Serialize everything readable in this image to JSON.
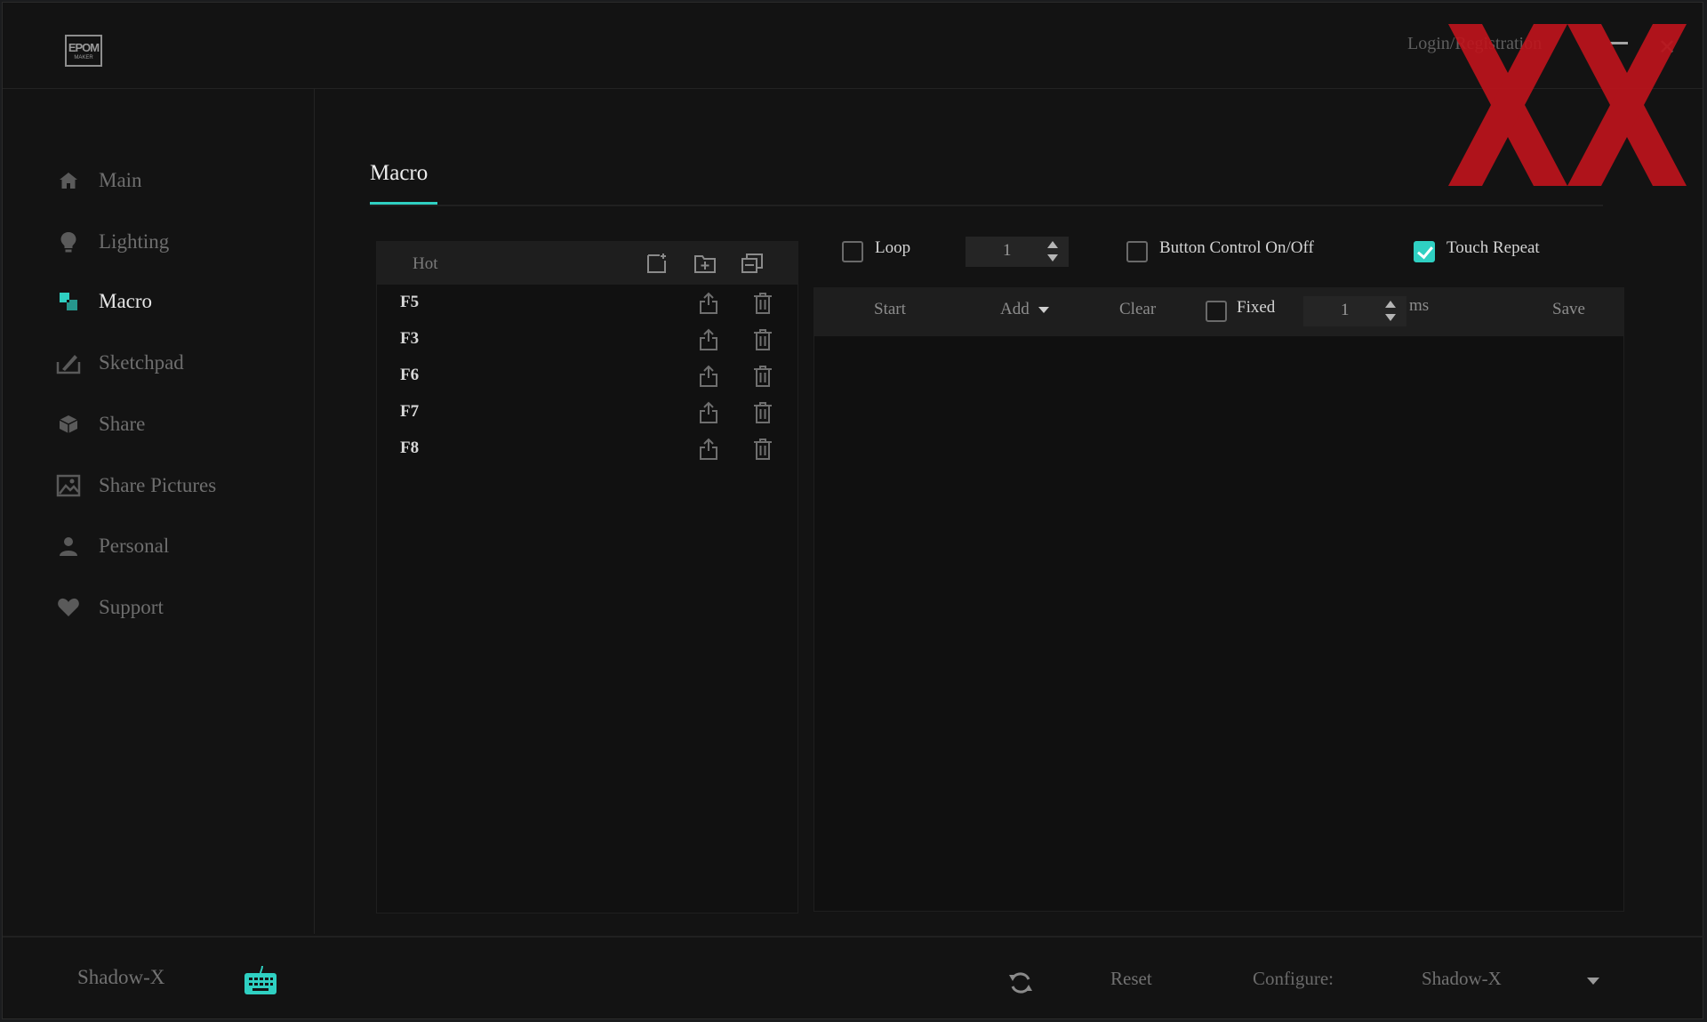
{
  "app": {
    "logo": {
      "line1": "EPOM",
      "line2": "MAKER"
    },
    "login_label": "Login/Registration"
  },
  "sidebar": {
    "items": [
      {
        "label": "Main",
        "icon": "home-icon"
      },
      {
        "label": "Lighting",
        "icon": "bulb-icon"
      },
      {
        "label": "Macro",
        "icon": "macro-icon",
        "active": true
      },
      {
        "label": "Sketchpad",
        "icon": "sketchpad-icon"
      },
      {
        "label": "Share",
        "icon": "cube-icon"
      },
      {
        "label": "Share Pictures",
        "icon": "picture-icon"
      },
      {
        "label": "Personal",
        "icon": "user-icon"
      },
      {
        "label": "Support",
        "icon": "heart-icon"
      }
    ]
  },
  "main": {
    "tab_title": "Macro",
    "hot_list": {
      "header": "Hot",
      "header_icons": [
        "new-macro-icon",
        "import-icon",
        "copy-icon"
      ],
      "items": [
        "F5",
        "F3",
        "F6",
        "F7",
        "F8"
      ]
    },
    "options": {
      "loop_label": "Loop",
      "loop_checked": false,
      "loop_count": "1",
      "button_control_label": "Button Control On/Off",
      "button_control_checked": false,
      "touch_repeat_label": "Touch Repeat",
      "touch_repeat_checked": true
    },
    "toolbar": {
      "start": "Start",
      "add": "Add",
      "clear": "Clear",
      "fixed_label": "Fixed",
      "fixed_checked": false,
      "fixed_value": "1",
      "unit": "ms",
      "save": "Save"
    }
  },
  "footer": {
    "device_name": "Shadow-X",
    "reset": "Reset",
    "configure_label": "Configure:",
    "configure_value": "Shadow-X"
  },
  "colors": {
    "accent": "#2fd0c2",
    "background": "#131313",
    "watermark": "#c0141c"
  }
}
